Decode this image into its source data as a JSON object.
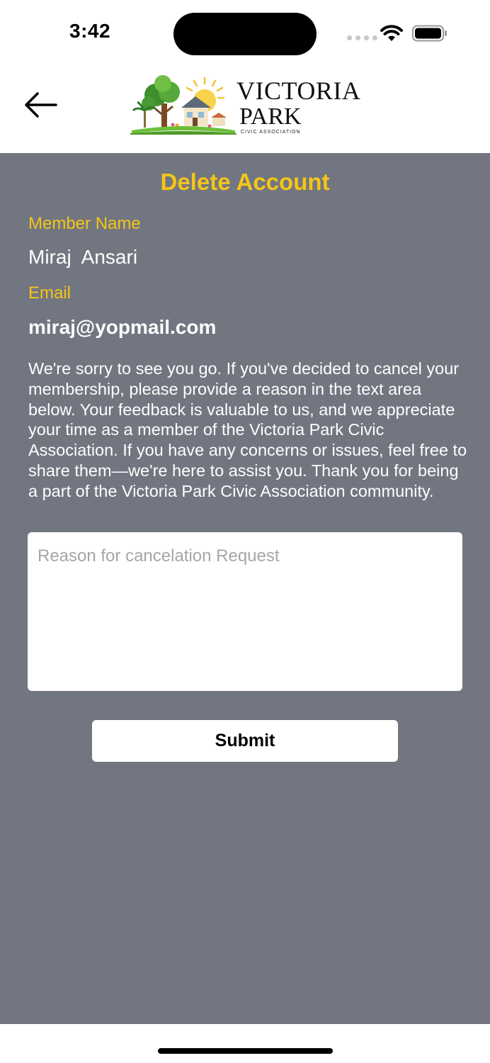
{
  "status_bar": {
    "time": "3:42",
    "icons": [
      "cellular-signal-icon",
      "wifi-icon",
      "battery-icon"
    ]
  },
  "header": {
    "back_icon": "arrow-left-icon",
    "logo": {
      "title": "VICTORIA",
      "subtitle": "PARK",
      "tagline": "CIVIC ASSOCIATION"
    }
  },
  "page": {
    "title": "Delete Account",
    "member_name_label": "Member Name",
    "member_name_value": "Miraj  Ansari",
    "email_label": "Email",
    "email_value": "miraj@yopmail.com",
    "message": "We're sorry to see you go. If you've decided to cancel your membership, please provide a reason in the text area below. Your feedback is valuable to us, and we appreciate your time as a member of the Victoria Park Civic Association. If you have any concerns or issues, feel free to share them—we're here to assist you. Thank you for being a part of the Victoria Park Civic Association community.",
    "reason_value": "",
    "reason_placeholder": "Reason for cancelation Request",
    "submit_label": "Submit"
  },
  "colors": {
    "panel_background": "#727680",
    "accent_yellow": "#f5c518",
    "text_white": "#ffffff"
  }
}
